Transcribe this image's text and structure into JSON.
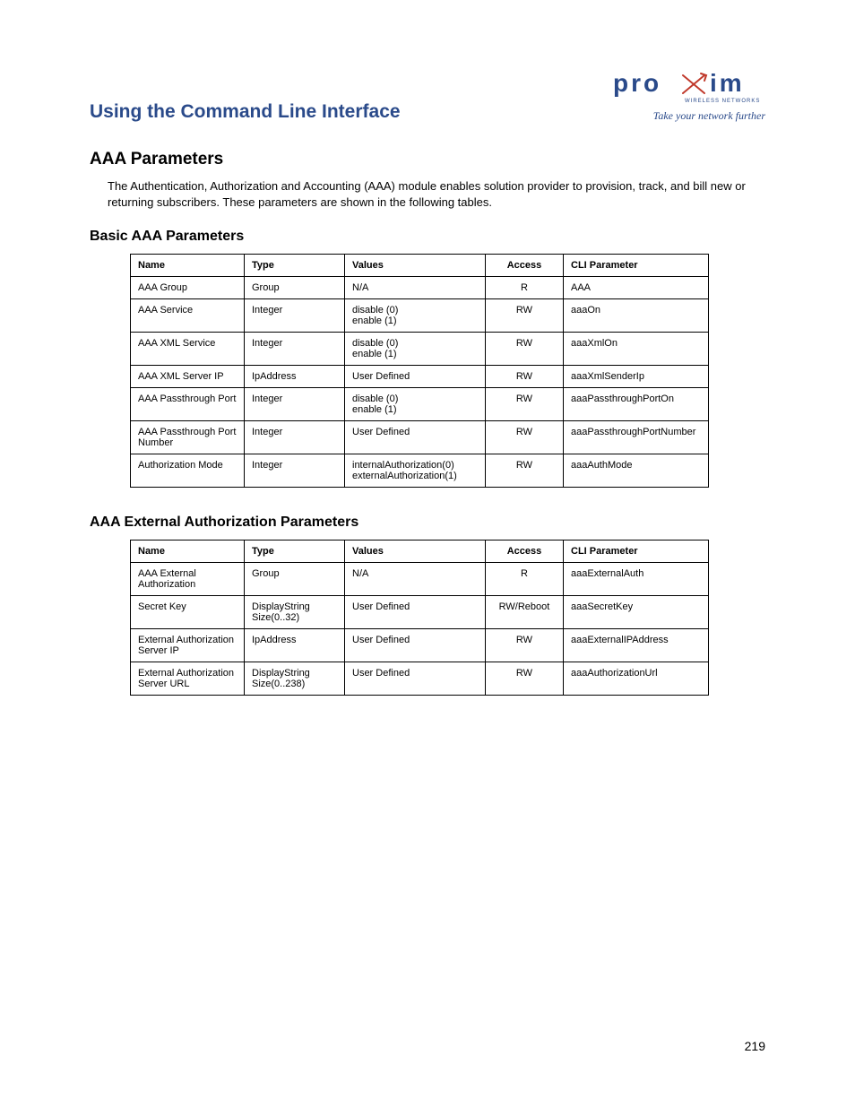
{
  "header": {
    "doc_title": "Using the Command Line Interface",
    "logo_sub": "WIRELESS NETWORKS",
    "logo_tag": "Take your network further"
  },
  "page_number": "219",
  "s1": {
    "title": "AAA Parameters",
    "intro": "The Authentication, Authorization and Accounting (AAA) module enables solution provider to provision, track, and bill new or returning subscribers. These parameters are shown in the following tables."
  },
  "t1": {
    "title": "Basic AAA Parameters",
    "h": {
      "name": "Name",
      "type": "Type",
      "values": "Values",
      "access": "Access",
      "cli": "CLI Parameter"
    },
    "r": [
      {
        "name": "AAA Group",
        "type": "Group",
        "values": "N/A",
        "access": "R",
        "cli": "AAA"
      },
      {
        "name": "AAA Service",
        "type": "Integer",
        "values": "disable (0)\nenable (1)",
        "access": "RW",
        "cli": "aaaOn"
      },
      {
        "name": "AAA XML Service",
        "type": "Integer",
        "values": "disable (0)\nenable (1)",
        "access": "RW",
        "cli": "aaaXmlOn"
      },
      {
        "name": "AAA XML Server IP",
        "type": "IpAddress",
        "values": "User Defined",
        "access": "RW",
        "cli": "aaaXmlSenderIp"
      },
      {
        "name": "AAA Passthrough Port",
        "type": "Integer",
        "values": "disable (0)\nenable (1)",
        "access": "RW",
        "cli": "aaaPassthroughPortOn"
      },
      {
        "name": "AAA Passthrough Port Number",
        "type": "Integer",
        "values": "User Defined",
        "access": "RW",
        "cli": "aaaPassthroughPortNumber"
      },
      {
        "name": "Authorization Mode",
        "type": "Integer",
        "values": "internalAuthorization(0)\nexternalAuthorization(1)",
        "access": "RW",
        "cli": "aaaAuthMode"
      }
    ]
  },
  "t2": {
    "title": "AAA External Authorization Parameters",
    "h": {
      "name": "Name",
      "type": "Type",
      "values": "Values",
      "access": "Access",
      "cli": "CLI Parameter"
    },
    "r": [
      {
        "name": "AAA External Authorization",
        "type": "Group",
        "values": "N/A",
        "access": "R",
        "cli": "aaaExternalAuth"
      },
      {
        "name": "Secret Key",
        "type": "DisplayString Size(0..32)",
        "values": "User Defined",
        "access": "RW/Reboot",
        "cli": "aaaSecretKey"
      },
      {
        "name": "External Authorization Server IP",
        "type": "IpAddress",
        "values": "User Defined",
        "access": "RW",
        "cli": "aaaExternalIPAddress"
      },
      {
        "name": "External Authorization Server URL",
        "type": "DisplayString Size(0..238)",
        "values": "User Defined",
        "access": "RW",
        "cli": "aaaAuthorizationUrl"
      }
    ]
  }
}
